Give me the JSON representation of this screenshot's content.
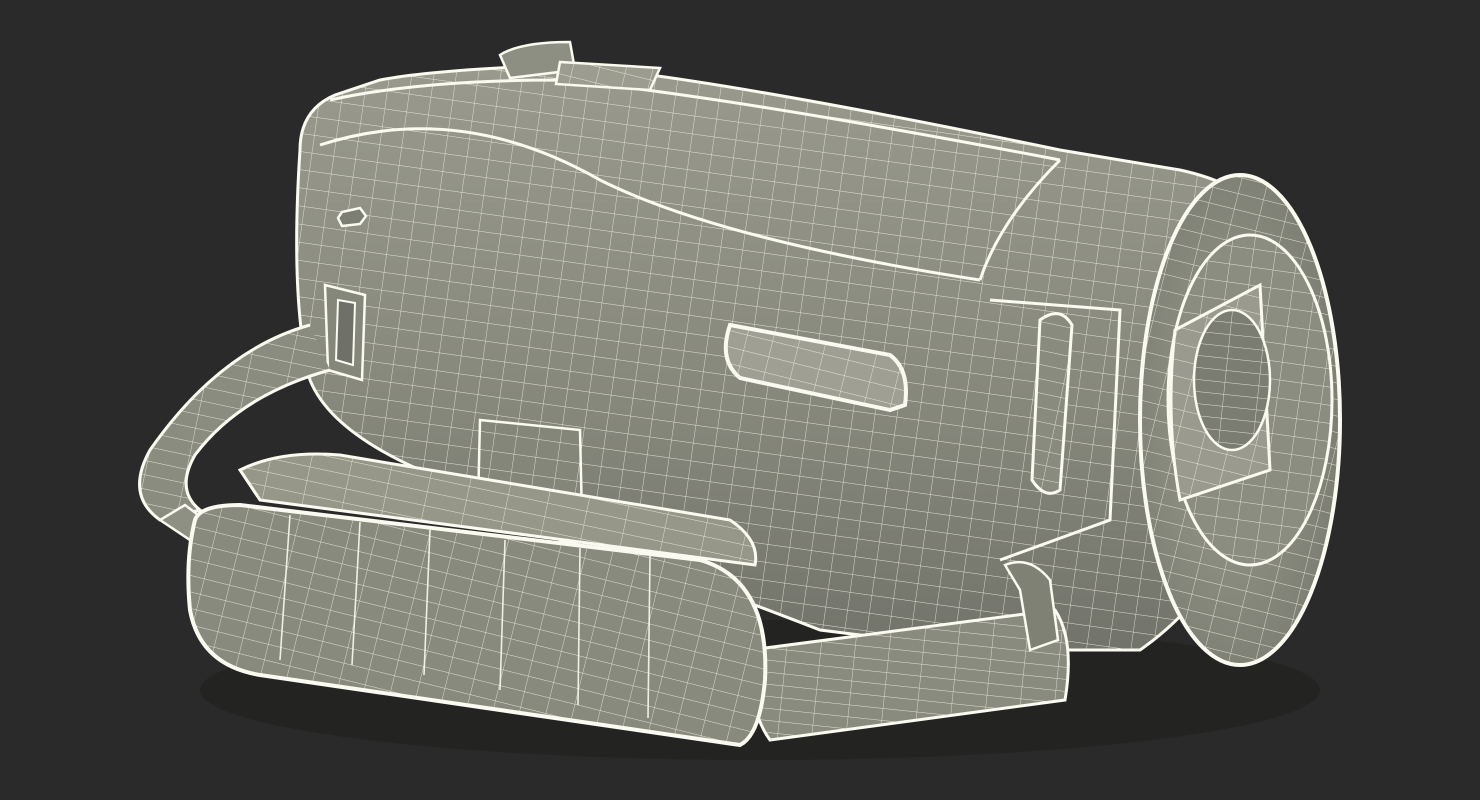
{
  "scene": {
    "subject": "camcorder-wireframe-render",
    "colors": {
      "background": "#2a2a2a",
      "surface": "#8a8b80",
      "surface_dark": "#6f7067",
      "surface_light": "#a3a497",
      "wire": "#f2f1e4",
      "edge": "#fbfaf0",
      "shadow": "#1e1e1c"
    }
  }
}
